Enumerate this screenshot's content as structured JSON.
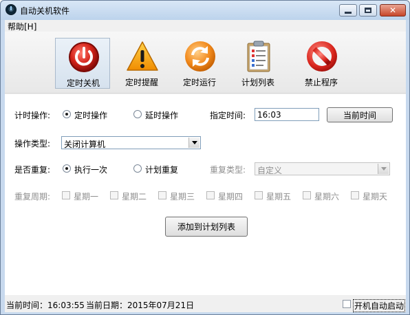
{
  "window": {
    "title": "自动关机软件"
  },
  "menu": {
    "help": "帮助[H]"
  },
  "toolbar": {
    "items": [
      {
        "label": "定时关机",
        "icon": "power-icon",
        "active": true
      },
      {
        "label": "定时提醒",
        "icon": "warning-icon",
        "active": false
      },
      {
        "label": "定时运行",
        "icon": "refresh-icon",
        "active": false
      },
      {
        "label": "计划列表",
        "icon": "clipboard-list-icon",
        "active": false
      },
      {
        "label": "禁止程序",
        "icon": "prohibited-icon",
        "active": false
      }
    ]
  },
  "form": {
    "timer_op_label": "计时操作:",
    "timer_options": [
      {
        "label": "定时操作",
        "checked": true
      },
      {
        "label": "延时操作",
        "checked": false
      }
    ],
    "specified_time_label": "指定时间:",
    "specified_time_value": "16:03",
    "current_time_button": "当前时间",
    "op_type_label": "操作类型:",
    "op_type_value": "关闭计算机",
    "repeat_label": "是否重复:",
    "repeat_options": [
      {
        "label": "执行一次",
        "checked": true
      },
      {
        "label": "计划重复",
        "checked": false
      }
    ],
    "repeat_type_label": "重复类型:",
    "repeat_type_value": "自定义",
    "repeat_period_label": "重复周期:",
    "weekdays": [
      "星期一",
      "星期二",
      "星期三",
      "星期四",
      "星期五",
      "星期六",
      "星期天"
    ],
    "add_button": "添加到计划列表"
  },
  "status": {
    "current_time": "当前时间：16:03:55",
    "current_date": "当前日期：2015年07月21日",
    "autostart_label": "开机自动启动",
    "autostart_checked": false
  }
}
